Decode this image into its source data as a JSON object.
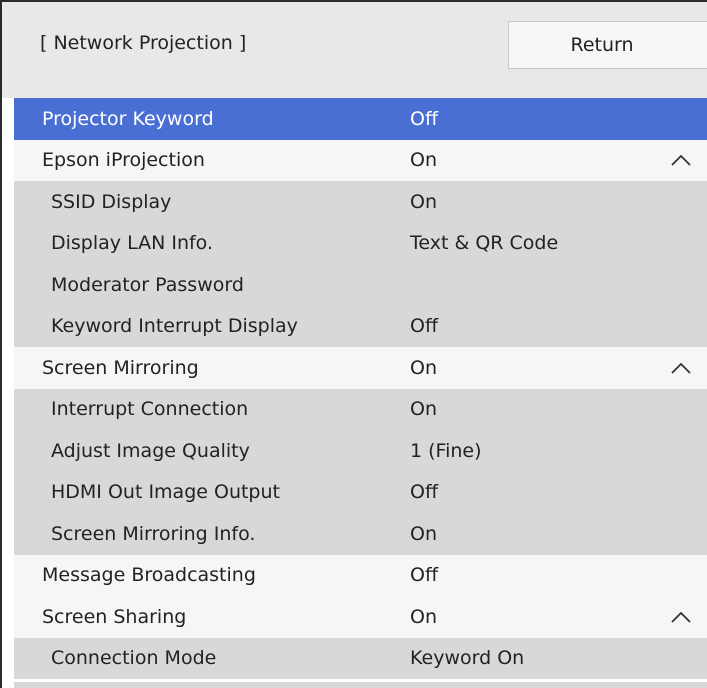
{
  "header": {
    "title": "[ Network Projection ]",
    "return_label": "Return"
  },
  "rows": [
    {
      "label": "Projector Keyword",
      "value": "Off",
      "level": "top",
      "selected": true,
      "chevron": false
    },
    {
      "label": "Epson iProjection",
      "value": "On",
      "level": "top",
      "selected": false,
      "chevron": true
    },
    {
      "label": "SSID Display",
      "value": "On",
      "level": "sub",
      "selected": false,
      "chevron": false
    },
    {
      "label": "Display LAN Info.",
      "value": "Text & QR Code",
      "level": "sub",
      "selected": false,
      "chevron": false
    },
    {
      "label": "Moderator Password",
      "value": "",
      "level": "sub",
      "selected": false,
      "chevron": false
    },
    {
      "label": "Keyword Interrupt Display",
      "value": "Off",
      "level": "sub",
      "selected": false,
      "chevron": false
    },
    {
      "label": "Screen Mirroring",
      "value": "On",
      "level": "top",
      "selected": false,
      "chevron": true
    },
    {
      "label": "Interrupt Connection",
      "value": "On",
      "level": "sub",
      "selected": false,
      "chevron": false
    },
    {
      "label": "Adjust Image Quality",
      "value": "1 (Fine)",
      "level": "sub",
      "selected": false,
      "chevron": false
    },
    {
      "label": "HDMI Out Image Output",
      "value": "Off",
      "level": "sub",
      "selected": false,
      "chevron": false
    },
    {
      "label": "Screen Mirroring Info.",
      "value": "On",
      "level": "sub",
      "selected": false,
      "chevron": false
    },
    {
      "label": "Message Broadcasting",
      "value": "Off",
      "level": "top",
      "selected": false,
      "chevron": false
    },
    {
      "label": "Screen Sharing",
      "value": "On",
      "level": "top",
      "selected": false,
      "chevron": true
    },
    {
      "label": "Connection Mode",
      "value": "Keyword On",
      "level": "sub",
      "selected": false,
      "chevron": false
    }
  ],
  "icons": {
    "collapse": "chevron-up-icon"
  },
  "colors": {
    "selected": "#4a6fd4",
    "top_row": "#f6f6f6",
    "sub_row": "#d8d8d8",
    "header": "#e8e8e8"
  }
}
